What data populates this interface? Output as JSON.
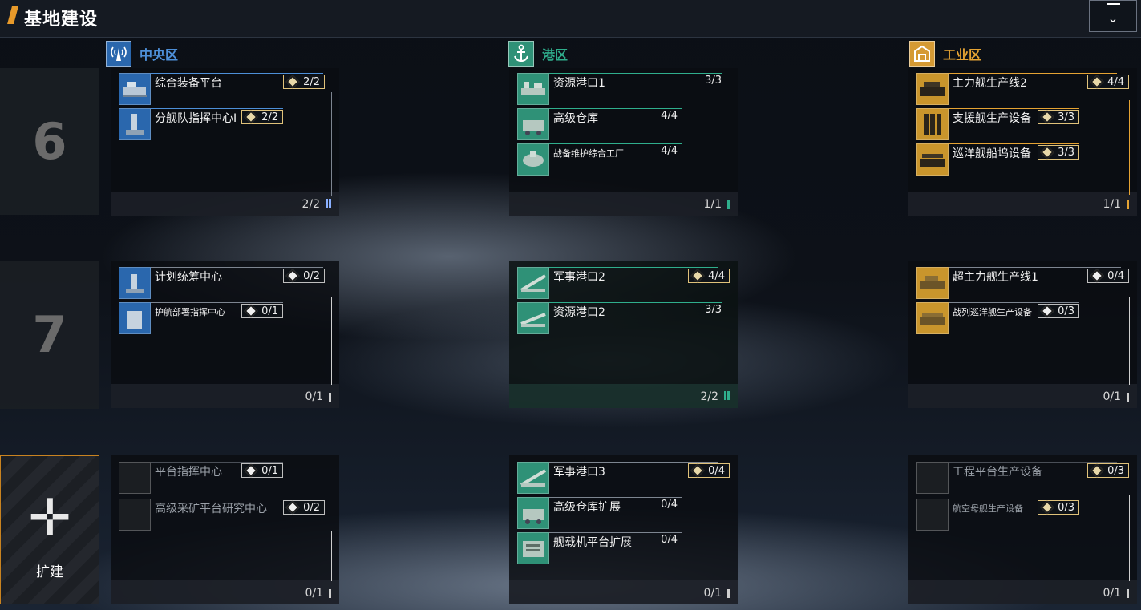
{
  "header": {
    "title": "基地建设",
    "collapse_symbol": "⌄"
  },
  "colors": {
    "blue": "#2a67ad",
    "teal": "#2f9177",
    "gold": "#d59a34",
    "accent": "#e89a2a"
  },
  "zones": [
    {
      "label": "中央区",
      "icon": "radio-tower-icon",
      "color": "#4d8fd8"
    },
    {
      "label": "港区",
      "icon": "anchor-icon",
      "color": "#2fae8c"
    },
    {
      "label": "工业区",
      "icon": "factory-icon",
      "color": "#e5a333"
    }
  ],
  "levels": {
    "l6": "6",
    "l7": "7"
  },
  "expand": {
    "label": "扩建"
  },
  "rows": [
    {
      "panels": [
        {
          "tally": "2/2",
          "items": [
            {
              "name": "综合装备平台",
              "count": "2/2"
            },
            {
              "name": "分舰队指挥中心I",
              "count": "2/2"
            }
          ]
        },
        {
          "tally": "1/1",
          "items": [
            {
              "name": "资源港口1",
              "count": "3/3"
            },
            {
              "name": "高级仓库",
              "count": "4/4"
            },
            {
              "name": "战备维护综合工厂",
              "count": "4/4"
            }
          ]
        },
        {
          "tally": "1/1",
          "items": [
            {
              "name": "主力舰生产线2",
              "count": "4/4"
            },
            {
              "name": "支援舰生产设备",
              "count": "3/3"
            },
            {
              "name": "巡洋舰船坞设备",
              "count": "3/3"
            }
          ]
        }
      ]
    },
    {
      "panels": [
        {
          "tally": "0/1",
          "items": [
            {
              "name": "计划统筹中心",
              "count": "0/2"
            },
            {
              "name": "护航部署指挥中心",
              "count": "0/1"
            }
          ]
        },
        {
          "tally": "2/2",
          "items": [
            {
              "name": "军事港口2",
              "count": "4/4"
            },
            {
              "name": "资源港口2",
              "count": "3/3"
            }
          ]
        },
        {
          "tally": "0/1",
          "items": [
            {
              "name": "超主力舰生产线1",
              "count": "0/4"
            },
            {
              "name": "战列巡洋舰生产设备",
              "count": "0/3"
            }
          ]
        }
      ]
    },
    {
      "panels": [
        {
          "tally": "0/1",
          "items": [
            {
              "name": "平台指挥中心",
              "count": "0/1"
            },
            {
              "name": "高级采矿平台研究中心",
              "count": "0/2"
            }
          ]
        },
        {
          "tally": "0/1",
          "items": [
            {
              "name": "军事港口3",
              "count": "0/4"
            },
            {
              "name": "高级仓库扩展",
              "count": "0/4"
            },
            {
              "name": "舰载机平台扩展",
              "count": "0/4"
            }
          ]
        },
        {
          "tally": "0/1",
          "items": [
            {
              "name": "工程平台生产设备",
              "count": "0/3"
            },
            {
              "name": "航空母舰生产设备",
              "count": "0/3"
            }
          ]
        }
      ]
    }
  ]
}
